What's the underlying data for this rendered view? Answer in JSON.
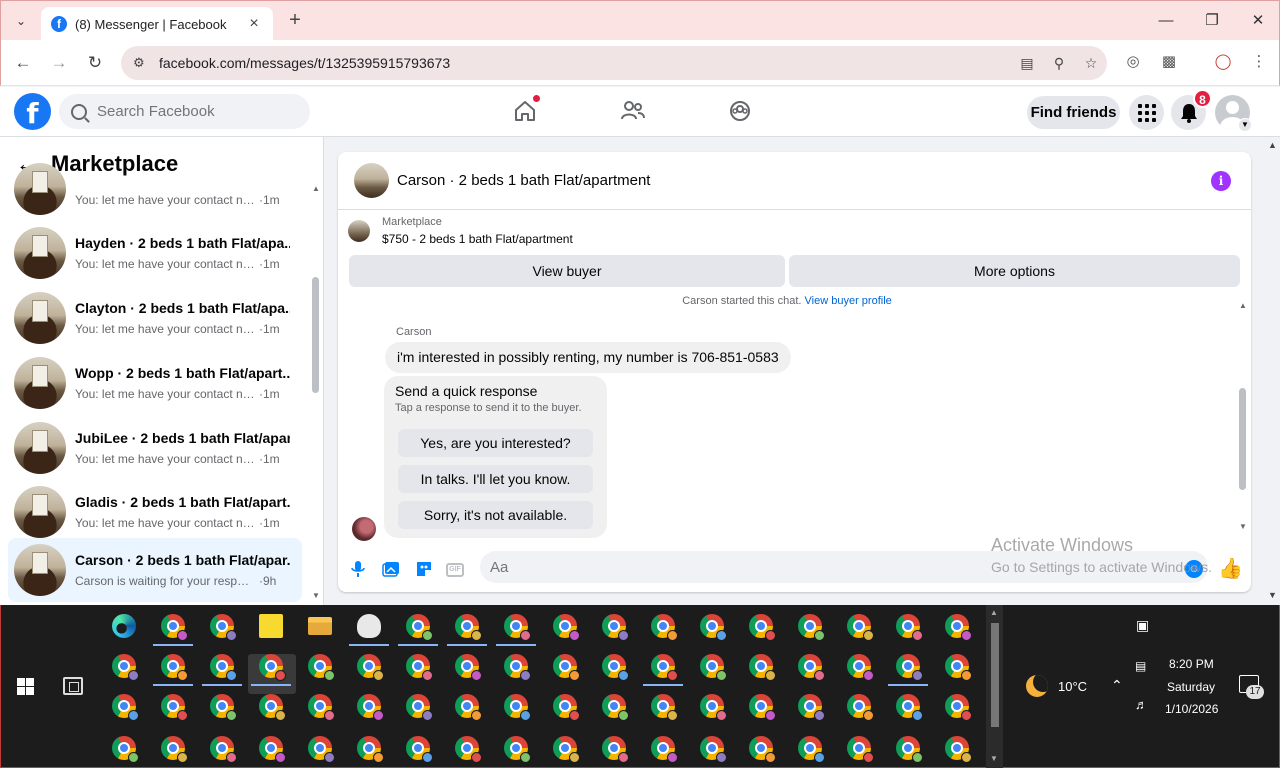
{
  "browser": {
    "tab_title": "(8) Messenger | Facebook",
    "url": "facebook.com/messages/t/1325395915793673"
  },
  "header": {
    "search_placeholder": "Search Facebook",
    "find_friends": "Find friends",
    "notification_count": "8"
  },
  "left": {
    "title": "Marketplace",
    "conversations": [
      {
        "name": "",
        "preview": "You: let me have your contact nu...",
        "time": "·1m"
      },
      {
        "name": "Hayden · 2 beds 1 bath Flat/apa...",
        "preview": "You: let me have your contact nu...",
        "time": "·1m"
      },
      {
        "name": "Clayton · 2 beds 1 bath Flat/apa...",
        "preview": "You: let me have your contact nu...",
        "time": "·1m"
      },
      {
        "name": "Wopp · 2 beds 1 bath Flat/apart...",
        "preview": "You: let me have your contact nu...",
        "time": "·1m"
      },
      {
        "name": "JubiLee · 2 beds 1 bath Flat/apar...",
        "preview": "You: let me have your contact nu...",
        "time": "·1m"
      },
      {
        "name": "Gladis · 2 beds 1 bath Flat/apart...",
        "preview": "You: let me have your contact nu...",
        "time": "·1m"
      },
      {
        "name": "Carson · 2 beds 1 bath Flat/apar...",
        "preview": "Carson is waiting for your response.",
        "time": "·9h"
      }
    ]
  },
  "chat": {
    "title": "Carson · 2 beds 1 bath Flat/apartment",
    "marketplace_label": "Marketplace",
    "listing": "$750 - 2 beds 1 bath Flat/apartment",
    "view_buyer": "View buyer",
    "more_options": "More options",
    "started_text": "Carson started this chat.",
    "view_buyer_profile": "View buyer profile",
    "sender": "Carson",
    "message": "i'm interested in possibly renting, my number is 706-851-0583",
    "quick_title": "Send a quick response",
    "quick_sub": "Tap a response to send it to the buyer.",
    "quick_replies": [
      "Yes, are you interested?",
      "In talks. I'll let you know.",
      "Sorry, it's not available."
    ],
    "input_placeholder": "Aa"
  },
  "watermark": {
    "line1": "Activate Windows",
    "line2": "Go to Settings to activate Windows."
  },
  "tray": {
    "temp": "10°C",
    "time": "8:20 PM",
    "day": "Saturday",
    "date": "1/10/2026",
    "notifications": "17"
  },
  "colors": {
    "fb_blue": "#1877f2",
    "messenger_blue": "#0084ff",
    "active_conv": "#ebf5ff",
    "badge_red": "#e41e3f",
    "info_purple": "#a033ff"
  }
}
